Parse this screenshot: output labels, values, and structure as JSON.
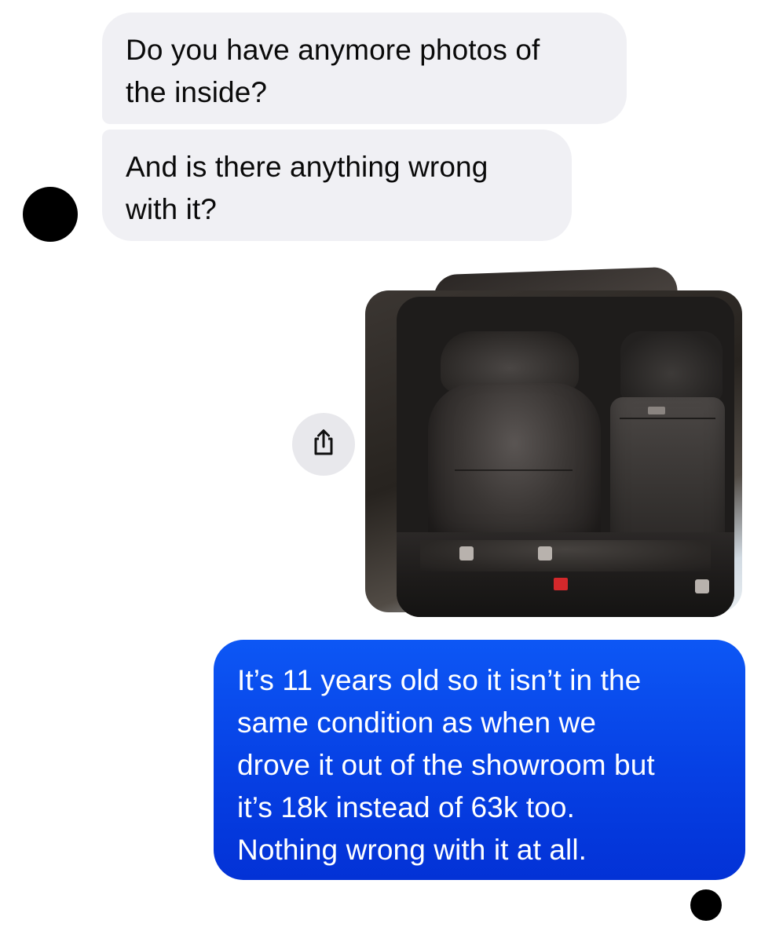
{
  "conversation": {
    "messages": [
      {
        "direction": "incoming",
        "text": "Do you have anymore photos of\nthe inside?"
      },
      {
        "direction": "incoming",
        "text": "And is there anything wrong\nwith it?"
      },
      {
        "direction": "outgoing",
        "text": "It’s 11 years old so it isn’t in the\nsame condition as when we\ndrove it out of the showroom but\nit’s 18k instead of 63k too.\nNothing wrong with it at all."
      }
    ],
    "attachment": {
      "type": "photo-stack",
      "photo_count": 3,
      "share_icon": "share-icon"
    }
  },
  "colors": {
    "incoming_bubble": "#f0f0f4",
    "outgoing_bubble": "#0a4cf0",
    "avatar": "#000000"
  }
}
